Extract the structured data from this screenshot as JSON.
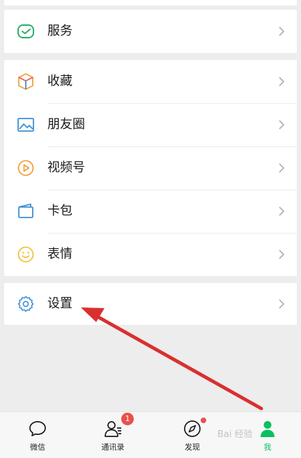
{
  "menu": {
    "services": {
      "label": "服务",
      "icon": "wechat-pay-icon"
    },
    "favorites": {
      "label": "收藏",
      "icon": "cube-icon"
    },
    "moments": {
      "label": "朋友圈",
      "icon": "image-icon"
    },
    "channels": {
      "label": "视频号",
      "icon": "play-circle-icon"
    },
    "cards": {
      "label": "卡包",
      "icon": "wallet-icon"
    },
    "stickers": {
      "label": "表情",
      "icon": "smiley-icon"
    },
    "settings": {
      "label": "设置",
      "icon": "gear-icon"
    }
  },
  "tabbar": {
    "tabs": [
      {
        "label": "微信",
        "icon": "chat-bubble-icon"
      },
      {
        "label": "通讯录",
        "icon": "contacts-icon",
        "badge": "1"
      },
      {
        "label": "发现",
        "icon": "compass-icon"
      },
      {
        "label": "我",
        "icon": "person-icon",
        "active": true
      }
    ]
  },
  "colors": {
    "accent_green": "#07c160",
    "badge_red": "#e8514a",
    "arrow_red": "#d9302f",
    "background": "#ededed"
  },
  "watermark": "Bai 经验"
}
